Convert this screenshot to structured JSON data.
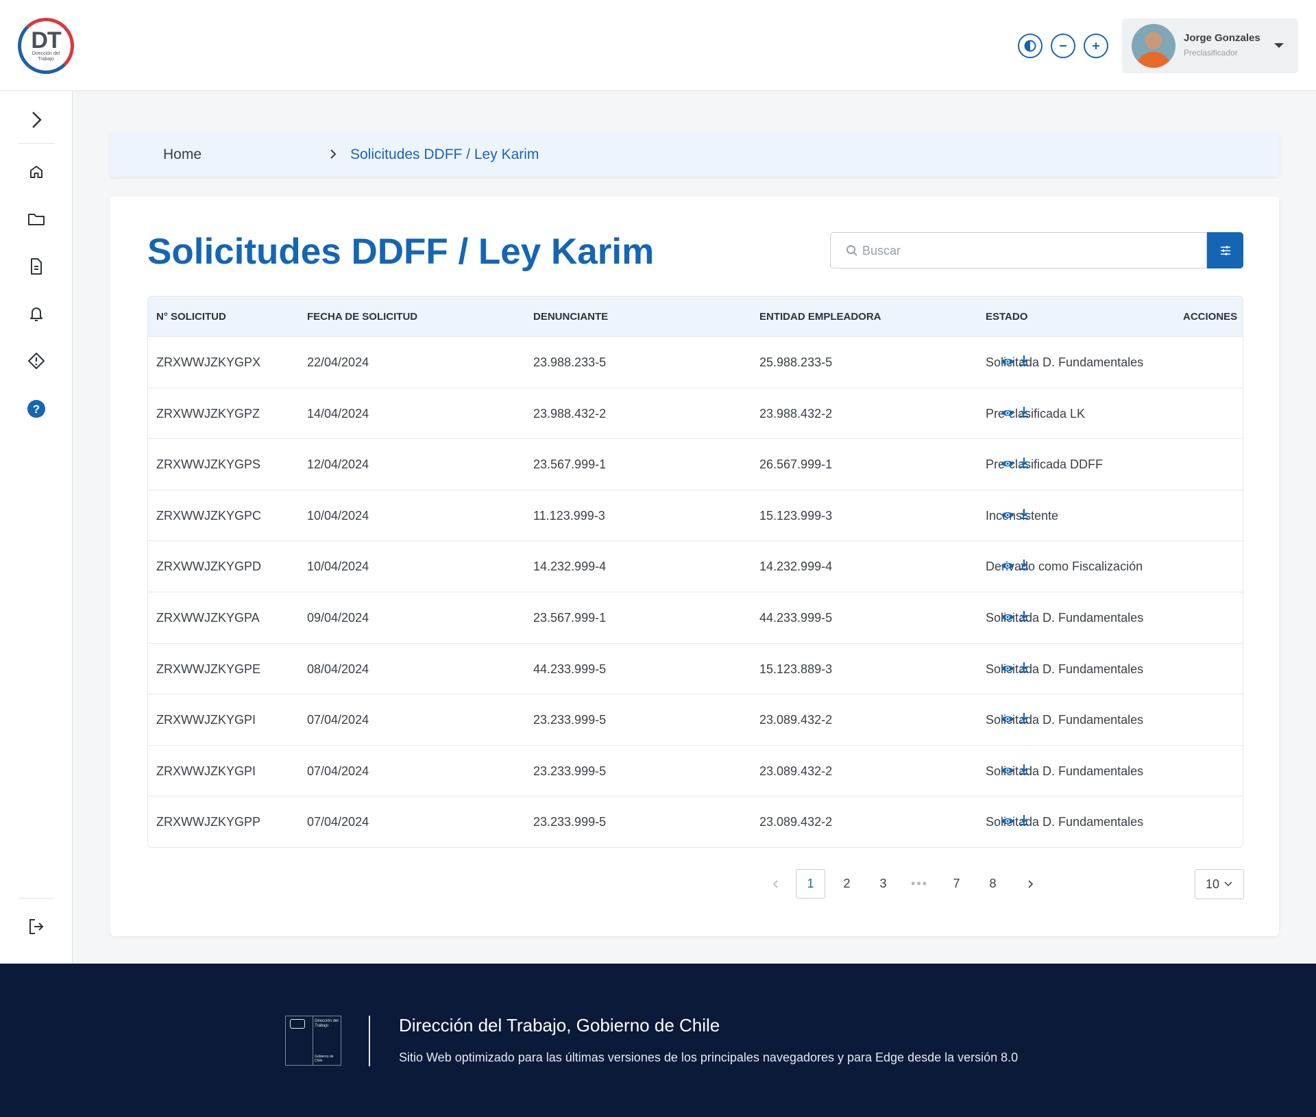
{
  "header": {
    "logo_text": "DT",
    "logo_sub": "Dirección del Trabajo",
    "user": {
      "name": "Jorge Gonzales",
      "role": "Preclasificador"
    }
  },
  "breadcrumb": {
    "home": "Home",
    "current": "Solicitudes DDFF / Ley Karim"
  },
  "page": {
    "title": "Solicitudes DDFF / Ley Karim"
  },
  "search": {
    "placeholder": "Buscar"
  },
  "table": {
    "headers": [
      "N° SOLICITUD",
      "FECHA DE SOLICITUD",
      "DENUNCIANTE",
      "ENTIDAD EMPLEADORA",
      "ESTADO",
      "ACCIONES"
    ],
    "rows": [
      [
        "ZRXWWJZKYGPX",
        "22/04/2024",
        "23.988.233-5",
        "25.988.233-5",
        "Solicitada D. Fundamentales"
      ],
      [
        "ZRXWWJZKYGPZ",
        "14/04/2024",
        "23.988.432-2",
        "23.988.432-2",
        "Pre-clasificada LK"
      ],
      [
        "ZRXWWJZKYGPS",
        "12/04/2024",
        "23.567.999-1",
        "26.567.999-1",
        "Pre-clasificada DDFF"
      ],
      [
        "ZRXWWJZKYGPC",
        "10/04/2024",
        "11.123.999-3",
        "15.123.999-3",
        "Inconsistente"
      ],
      [
        "ZRXWWJZKYGPD",
        "10/04/2024",
        "14.232.999-4",
        "14.232.999-4",
        "Derivado como Fiscalización"
      ],
      [
        "ZRXWWJZKYGPA",
        "09/04/2024",
        "23.567.999-1",
        "44.233.999-5",
        "Solicitada D. Fundamentales"
      ],
      [
        "ZRXWWJZKYGPE",
        "08/04/2024",
        "44.233.999-5",
        "15.123.889-3",
        "Solicitada D. Fundamentales"
      ],
      [
        "ZRXWWJZKYGPI",
        "07/04/2024",
        "23.233.999-5",
        "23.089.432-2",
        "Solicitada D. Fundamentales"
      ],
      [
        "ZRXWWJZKYGPI",
        "07/04/2024",
        "23.233.999-5",
        "23.089.432-2",
        "Solicitada D. Fundamentales"
      ],
      [
        "ZRXWWJZKYGPP",
        "07/04/2024",
        "23.233.999-5",
        "23.089.432-2",
        "Solicitada D. Fundamentales"
      ]
    ]
  },
  "pagination": {
    "pages": [
      "1",
      "2",
      "3",
      "•••",
      "7",
      "8"
    ],
    "current": "1",
    "page_size": "10"
  },
  "footer": {
    "logo_top": "Dirección del Trabajo",
    "logo_bottom": "Gobierno de Chile",
    "title": "Dirección del Trabajo, Gobierno de Chile",
    "subtitle": "Sitio Web optimizado para las últimas versiones de los principales navegadores y para Edge desde la versión 8.0"
  },
  "colors": {
    "primary": "#1565b5",
    "footer_bg": "#0b1a38",
    "table_header_bg": "#eef4fb"
  }
}
